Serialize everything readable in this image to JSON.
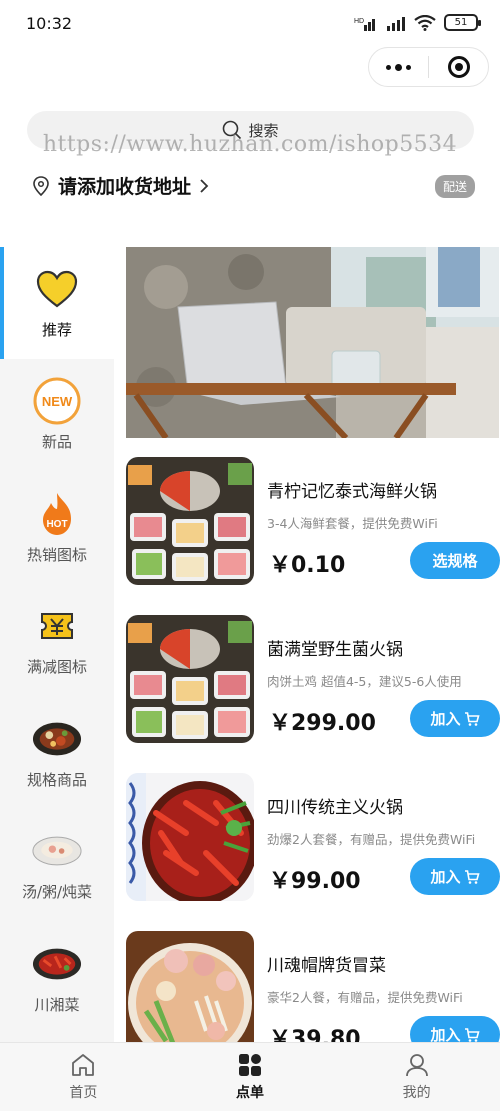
{
  "status_bar": {
    "time": "10:32",
    "battery": "51"
  },
  "header": {
    "search_placeholder": "搜索",
    "watermark": "https://www.huzhan.com/ishop5534",
    "address": "请添加收货地址",
    "delivery_badge": "配送"
  },
  "sidebar": {
    "items": [
      {
        "label": "推荐",
        "icon": "heart-icon",
        "active": true
      },
      {
        "label": "新品",
        "icon": "new-badge-icon",
        "icon_text": "NEW"
      },
      {
        "label": "热销图标",
        "icon": "hot-flame-icon",
        "icon_text": "HOT"
      },
      {
        "label": "满减图标",
        "icon": "coupon-icon"
      },
      {
        "label": "规格商品",
        "icon": "food-bowl-icon"
      },
      {
        "label": "汤/粥/炖菜",
        "icon": "soup-plate-icon"
      },
      {
        "label": "川湘菜",
        "icon": "chili-dish-icon"
      }
    ]
  },
  "products": [
    {
      "name": "青柠记忆泰式海鲜火锅",
      "desc": "3-4人海鲜套餐，提供免费WiFi",
      "price": "￥0.10",
      "action": "选规格",
      "image": "hotpot-platter-image"
    },
    {
      "name": "菌满堂野生菌火锅",
      "desc": "肉饼土鸡 超值4-5，建议5-6人使用",
      "price": "￥299.00",
      "action": "加入",
      "image": "hotpot-platter-image"
    },
    {
      "name": "四川传统主义火锅",
      "desc": "劲爆2人套餐，有赠品，提供免费WiFi",
      "price": "￥99.00",
      "action": "加入",
      "image": "chili-hotpot-image"
    },
    {
      "name": "川魂帽牌货冒菜",
      "desc": "豪华2人餐，有赠品，提供免费WiFi",
      "price": "￥39.80",
      "action": "加入",
      "image": "maocai-bowl-image"
    }
  ],
  "tab_bar": [
    {
      "label": "首页",
      "icon": "home-icon"
    },
    {
      "label": "点单",
      "icon": "grid-icon",
      "active": true
    },
    {
      "label": "我的",
      "icon": "user-icon"
    }
  ],
  "colors": {
    "accent": "#2aa2f0",
    "hot": "#f07a1a",
    "sidebar_bg": "#f5f5f5"
  }
}
